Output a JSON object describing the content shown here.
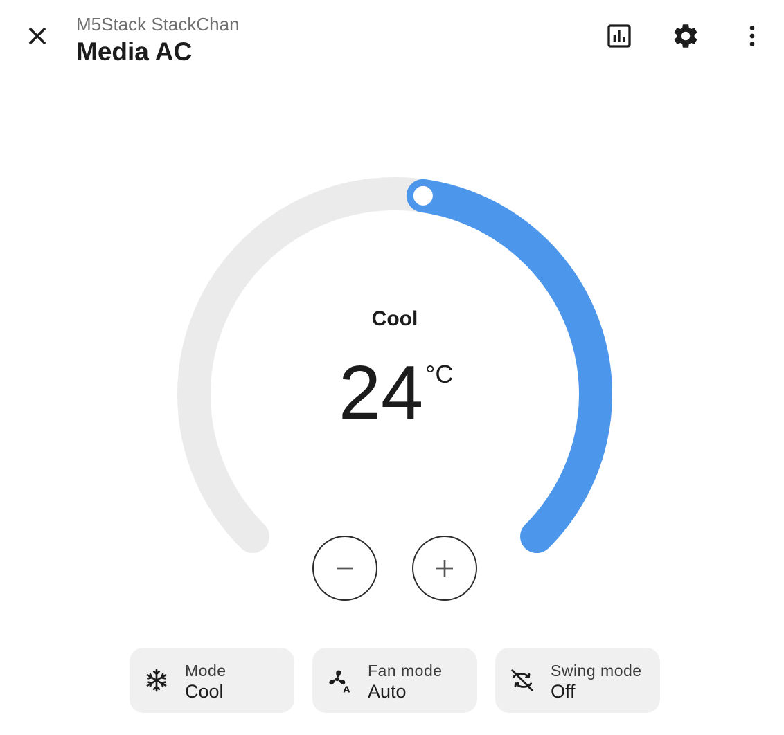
{
  "header": {
    "device": "M5Stack StackChan",
    "title": "Media AC",
    "icons": [
      "close-icon",
      "history-chart-icon",
      "settings-icon",
      "more-vertical-icon"
    ]
  },
  "thermostat": {
    "hvac_mode": "Cool",
    "target_temperature": "24",
    "unit": "°C",
    "fraction": 0.53,
    "colors": {
      "active": "#4C97EB",
      "track": "#EBEBEB"
    }
  },
  "controls": {
    "decrease_icon": "minus-icon",
    "increase_icon": "plus-icon"
  },
  "features": [
    {
      "name": "Mode",
      "value": "Cool",
      "icon": "snowflake-icon"
    },
    {
      "name": "Fan mode",
      "value": "Auto",
      "icon": "fan-auto-icon"
    },
    {
      "name": "Swing mode",
      "value": "Off",
      "icon": "swing-off-icon"
    }
  ]
}
